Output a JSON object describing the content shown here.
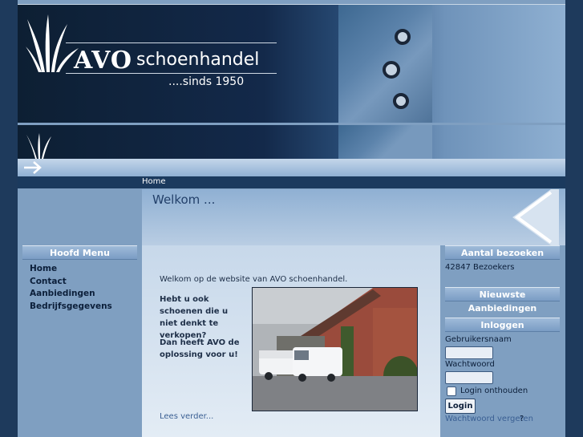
{
  "header": {
    "brand": "AVO",
    "shop_name": "schoenhandel",
    "since": "....sinds 1950"
  },
  "breadcrumb": "Home",
  "page_title": "Welkom ...",
  "main_menu": {
    "title": "Hoofd Menu",
    "items": [
      {
        "label": "Home"
      },
      {
        "label": "Contact"
      },
      {
        "label": "Aanbiedingen"
      },
      {
        "label": "Bedrijfsgegevens"
      }
    ]
  },
  "content": {
    "intro": "Welkom op de website van AVO schoenhandel.",
    "question1": "Hebt u ook schoenen die u niet denkt te verkopen?",
    "question2": "Dan heeft AVO de oplossing voor u!",
    "read_more": "Lees verder..."
  },
  "visits": {
    "title": "Aantal bezoeken",
    "text": "42847 Bezoekers"
  },
  "offers": {
    "title": "Nieuwste Aanbiedingen"
  },
  "login": {
    "title": "Inloggen",
    "username_label": "Gebruikersnaam",
    "password_label": "Wachtwoord",
    "username_value": "",
    "password_value": "",
    "remember_label": "Login onthouden",
    "button": "Login",
    "forgot": "Wachtwoord vergeten",
    "forgot_suffix": "?"
  }
}
